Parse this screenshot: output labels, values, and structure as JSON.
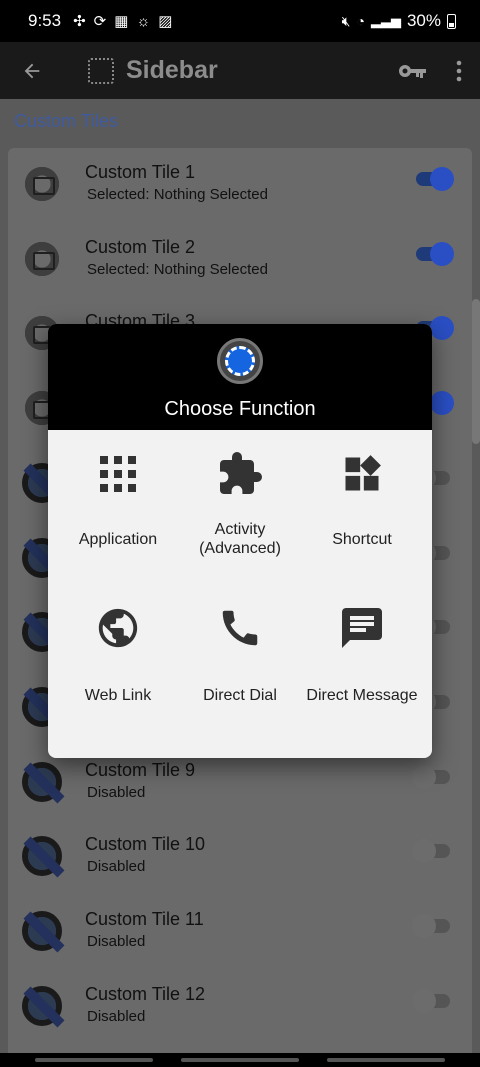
{
  "status": {
    "time": "9:53",
    "battery": "30%"
  },
  "appbar": {
    "title": "Sidebar"
  },
  "section": {
    "title": "Custom Tiles"
  },
  "tiles": [
    {
      "name": "Custom Tile 1",
      "sub": "Selected: Nothing Selected",
      "enabled": true,
      "icon": "gear-tile-icon"
    },
    {
      "name": "Custom Tile 2",
      "sub": "Selected: Nothing Selected",
      "enabled": true,
      "icon": "gear-tile-icon"
    },
    {
      "name": "Custom Tile 3",
      "sub": "",
      "enabled": true,
      "icon": "gear-tile-icon"
    },
    {
      "name": "",
      "sub": "",
      "enabled": true,
      "icon": "gear-tile-icon"
    },
    {
      "name": "",
      "sub": "",
      "enabled": false,
      "icon": "premium-badge-icon"
    },
    {
      "name": "",
      "sub": "",
      "enabled": false,
      "icon": "premium-badge-icon"
    },
    {
      "name": "",
      "sub": "",
      "enabled": false,
      "icon": "premium-badge-icon"
    },
    {
      "name": "",
      "sub": "",
      "enabled": false,
      "icon": "premium-badge-icon"
    },
    {
      "name": "Custom Tile 9",
      "sub": "Disabled",
      "enabled": false,
      "icon": "premium-badge-icon"
    },
    {
      "name": "Custom Tile 10",
      "sub": "Disabled",
      "enabled": false,
      "icon": "premium-badge-icon"
    },
    {
      "name": "Custom Tile 11",
      "sub": "Disabled",
      "enabled": false,
      "icon": "premium-badge-icon"
    },
    {
      "name": "Custom Tile 12",
      "sub": "Disabled",
      "enabled": false,
      "icon": "premium-badge-icon"
    }
  ],
  "dialog": {
    "title": "Choose Function",
    "options": {
      "application": "Application",
      "activity": "Activity\n(Advanced)",
      "shortcut": "Shortcut",
      "web_link": "Web Link",
      "direct_dial": "Direct Dial",
      "direct_message": "Direct Message"
    }
  }
}
